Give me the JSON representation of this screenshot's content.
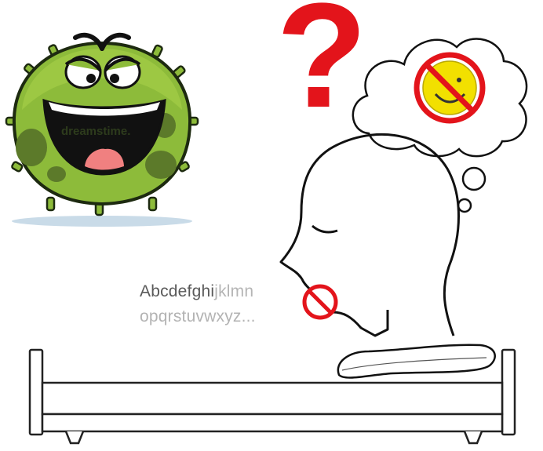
{
  "watermark": "dreamstime.",
  "question_mark": "?",
  "alphabet": {
    "line1_dark": "Abcdefghi",
    "line1_light": "jklmn",
    "line2": "opqrstuvwxyz..."
  },
  "colors": {
    "germ_body": "#8dbb3a",
    "germ_spots": "#5c7a2a",
    "prohibition_red": "#e3141b",
    "smiley_yellow": "#f2e000",
    "outline": "#111111"
  }
}
